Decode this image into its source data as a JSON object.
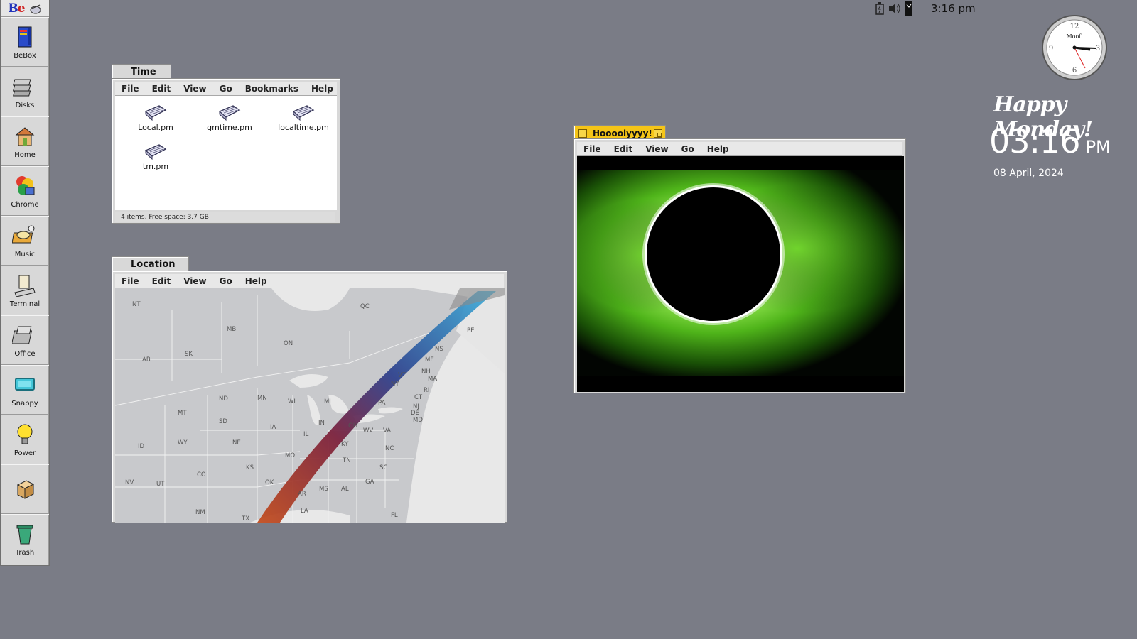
{
  "deskbar": {
    "items": [
      {
        "label": "BeBox",
        "icon": "bebox-icon"
      },
      {
        "label": "Disks",
        "icon": "disks-icon"
      },
      {
        "label": "Home",
        "icon": "home-icon"
      },
      {
        "label": "Chrome",
        "icon": "chrome-icon"
      },
      {
        "label": "Music",
        "icon": "music-icon"
      },
      {
        "label": "Terminal",
        "icon": "terminal-icon"
      },
      {
        "label": "Office",
        "icon": "office-icon"
      },
      {
        "label": "Snappy",
        "icon": "snappy-icon"
      },
      {
        "label": "Power",
        "icon": "power-icon"
      },
      {
        "label": "",
        "icon": "package-icon"
      },
      {
        "label": "Trash",
        "icon": "trash-icon"
      }
    ]
  },
  "tray": {
    "clock": "3:16 pm",
    "icons": [
      "battery-icon",
      "volume-icon",
      "bookmark-icon"
    ]
  },
  "time_window": {
    "title": "Time",
    "menu": [
      "File",
      "Edit",
      "View",
      "Go",
      "Bookmarks",
      "Help"
    ],
    "files": [
      "Local.pm",
      "gmtime.pm",
      "localtime.pm",
      "tm.pm"
    ],
    "status": "4 items, Free space: 3.7 GB"
  },
  "location_window": {
    "title": "Location",
    "menu": [
      "File",
      "Edit",
      "View",
      "Go",
      "Help"
    ],
    "map_labels": [
      "NT",
      "MB",
      "ON",
      "QC",
      "AB",
      "SK",
      "PE",
      "NS",
      "ME",
      "NH",
      "MA",
      "RI",
      "CT",
      "NJ",
      "DE",
      "MD",
      "VT",
      "NY",
      "PA",
      "MI",
      "WI",
      "MN",
      "ND",
      "SD",
      "MT",
      "WY",
      "ID",
      "NE",
      "IA",
      "IL",
      "IN",
      "OH",
      "WV",
      "VA",
      "KY",
      "NC",
      "TN",
      "SC",
      "GA",
      "AL",
      "MS",
      "AR",
      "LA",
      "OK",
      "KS",
      "MO",
      "CO",
      "UT",
      "NV",
      "NM",
      "TX",
      "FL"
    ]
  },
  "image_window": {
    "title": "Hoooolyyyy!",
    "menu": [
      "File",
      "Edit",
      "View",
      "Go",
      "Help"
    ]
  },
  "desktop": {
    "analog_clock_brand": "Moof.",
    "greeting": "Happy Monday!",
    "time": "03:16",
    "ampm": "PM",
    "date": "08 April, 2024"
  },
  "colors": {
    "desktop": "#7a7c86",
    "window_chrome": "#d8d8d8",
    "active_tab": "#f5c518",
    "eclipse_glow": "#5fcf1f"
  }
}
